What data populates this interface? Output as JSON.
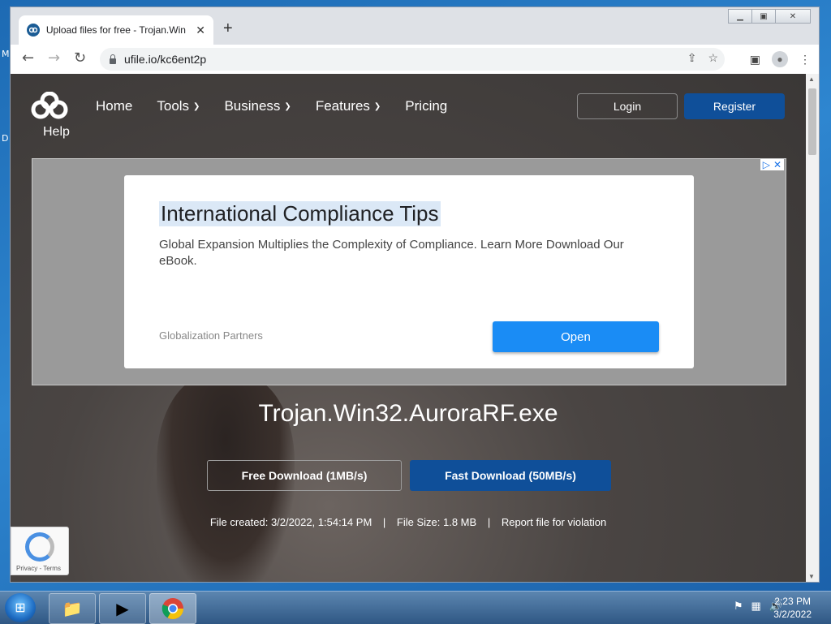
{
  "browser": {
    "tab_title": "Upload files for free - Trojan.Win",
    "tab_close": "✕",
    "new_tab": "+",
    "url": "ufile.io/kc6ent2p"
  },
  "site": {
    "logo_text": "Help",
    "nav": [
      {
        "label": "Home",
        "has_dropdown": false
      },
      {
        "label": "Tools",
        "has_dropdown": true
      },
      {
        "label": "Business",
        "has_dropdown": true
      },
      {
        "label": "Features",
        "has_dropdown": true
      },
      {
        "label": "Pricing",
        "has_dropdown": false
      }
    ],
    "login_label": "Login",
    "register_label": "Register"
  },
  "ad": {
    "title": "International Compliance Tips",
    "description": "Global Expansion Multiplies the Complexity of Compliance. Learn More Download Our eBook.",
    "sponsor": "Globalization Partners",
    "cta": "Open"
  },
  "file": {
    "name": "Trojan.Win32.AuroraRF.exe",
    "free_download": "Free Download (1MB/s)",
    "fast_download": "Fast Download (50MB/s)",
    "created": "File created: 3/2/2022, 1:54:14 PM",
    "size": "File Size: 1.8 MB",
    "report": "Report file for violation",
    "separator": "|"
  },
  "recaptcha": {
    "text": "Privacy - Terms"
  },
  "taskbar": {
    "time": "2:23 PM",
    "date": "3/2/2022"
  },
  "desktop": {
    "letters": [
      "M",
      "D"
    ]
  },
  "colors": {
    "accent": "#0f4f99",
    "ad_button": "#1a8cf5"
  }
}
